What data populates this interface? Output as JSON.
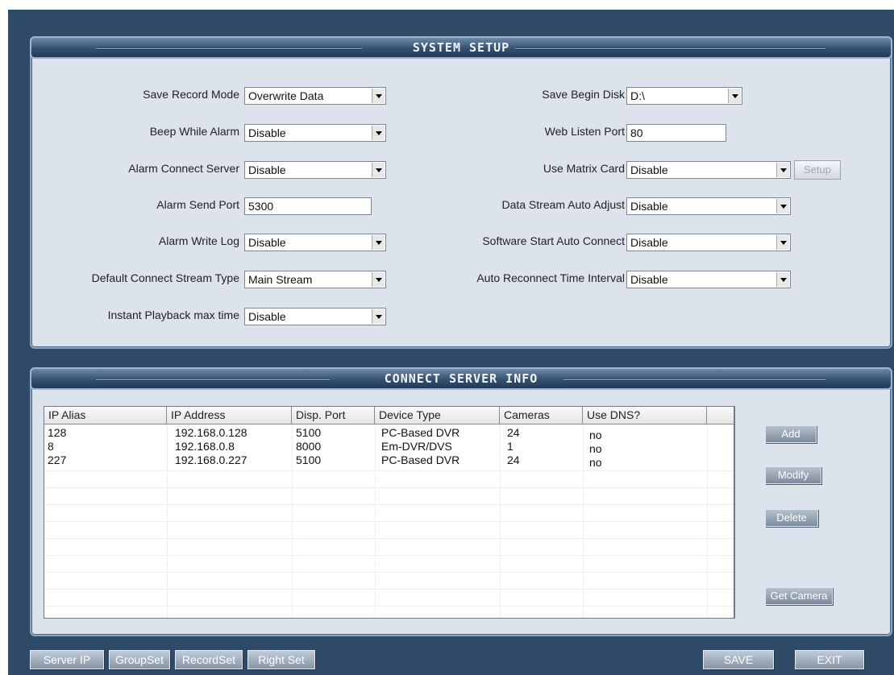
{
  "system_setup": {
    "title": "SYSTEM  SETUP",
    "left_fields": [
      {
        "label": "Save Record Mode",
        "value": "Overwrite Data",
        "type": "select"
      },
      {
        "label": "Beep While Alarm",
        "value": "Disable",
        "type": "select"
      },
      {
        "label": "Alarm  Connect Server",
        "value": "Disable",
        "type": "select"
      },
      {
        "label": "Alarm Send Port",
        "value": "5300",
        "type": "text"
      },
      {
        "label": "Alarm Write Log",
        "value": "Disable",
        "type": "select"
      },
      {
        "label": "Default Connect Stream Type",
        "value": "Main Stream",
        "type": "select"
      },
      {
        "label": "Instant Playback  max  time",
        "value": "Disable",
        "type": "select"
      }
    ],
    "right_fields": [
      {
        "label": "Save Begin Disk",
        "value": "D:\\",
        "type": "select"
      },
      {
        "label": "Web Listen Port",
        "value": "80",
        "type": "text"
      },
      {
        "label": "Use Matrix Card",
        "value": "Disable",
        "type": "select"
      },
      {
        "label": "Data Stream Auto Adjust",
        "value": "Disable",
        "type": "select"
      },
      {
        "label": "Software Start Auto Connect",
        "value": "Disable",
        "type": "select"
      },
      {
        "label": "Auto Reconnect Time Interval",
        "value": "Disable",
        "type": "select"
      }
    ],
    "setup_button": "Setup"
  },
  "connect_server_info": {
    "title": "CONNECT  SERVER  INFO",
    "columns": [
      "IP Alias",
      "IP Address",
      "Disp. Port",
      "Device Type",
      "Cameras",
      "Use DNS?"
    ],
    "rows": [
      [
        "128",
        "192.168.0.128",
        "5100",
        "PC-Based DVR",
        "24",
        "no"
      ],
      [
        "8",
        "192.168.0.8",
        "8000",
        "Em-DVR/DVS",
        "1",
        "no"
      ],
      [
        "227",
        "192.168.0.227",
        "5100",
        "PC-Based DVR",
        "24",
        "no"
      ]
    ],
    "buttons": {
      "add": "Add",
      "modify": "Modify",
      "delete": "Delete",
      "get_camera": "Get Camera"
    }
  },
  "bottom_tabs": [
    "Server IP",
    "GroupSet",
    "RecordSet",
    "Right Set"
  ],
  "bottom_actions": {
    "save": "SAVE",
    "exit": "EXIT"
  },
  "colors": {
    "frame": "#2f4a66",
    "panel": "#dce3ec",
    "header": "#34516f"
  }
}
